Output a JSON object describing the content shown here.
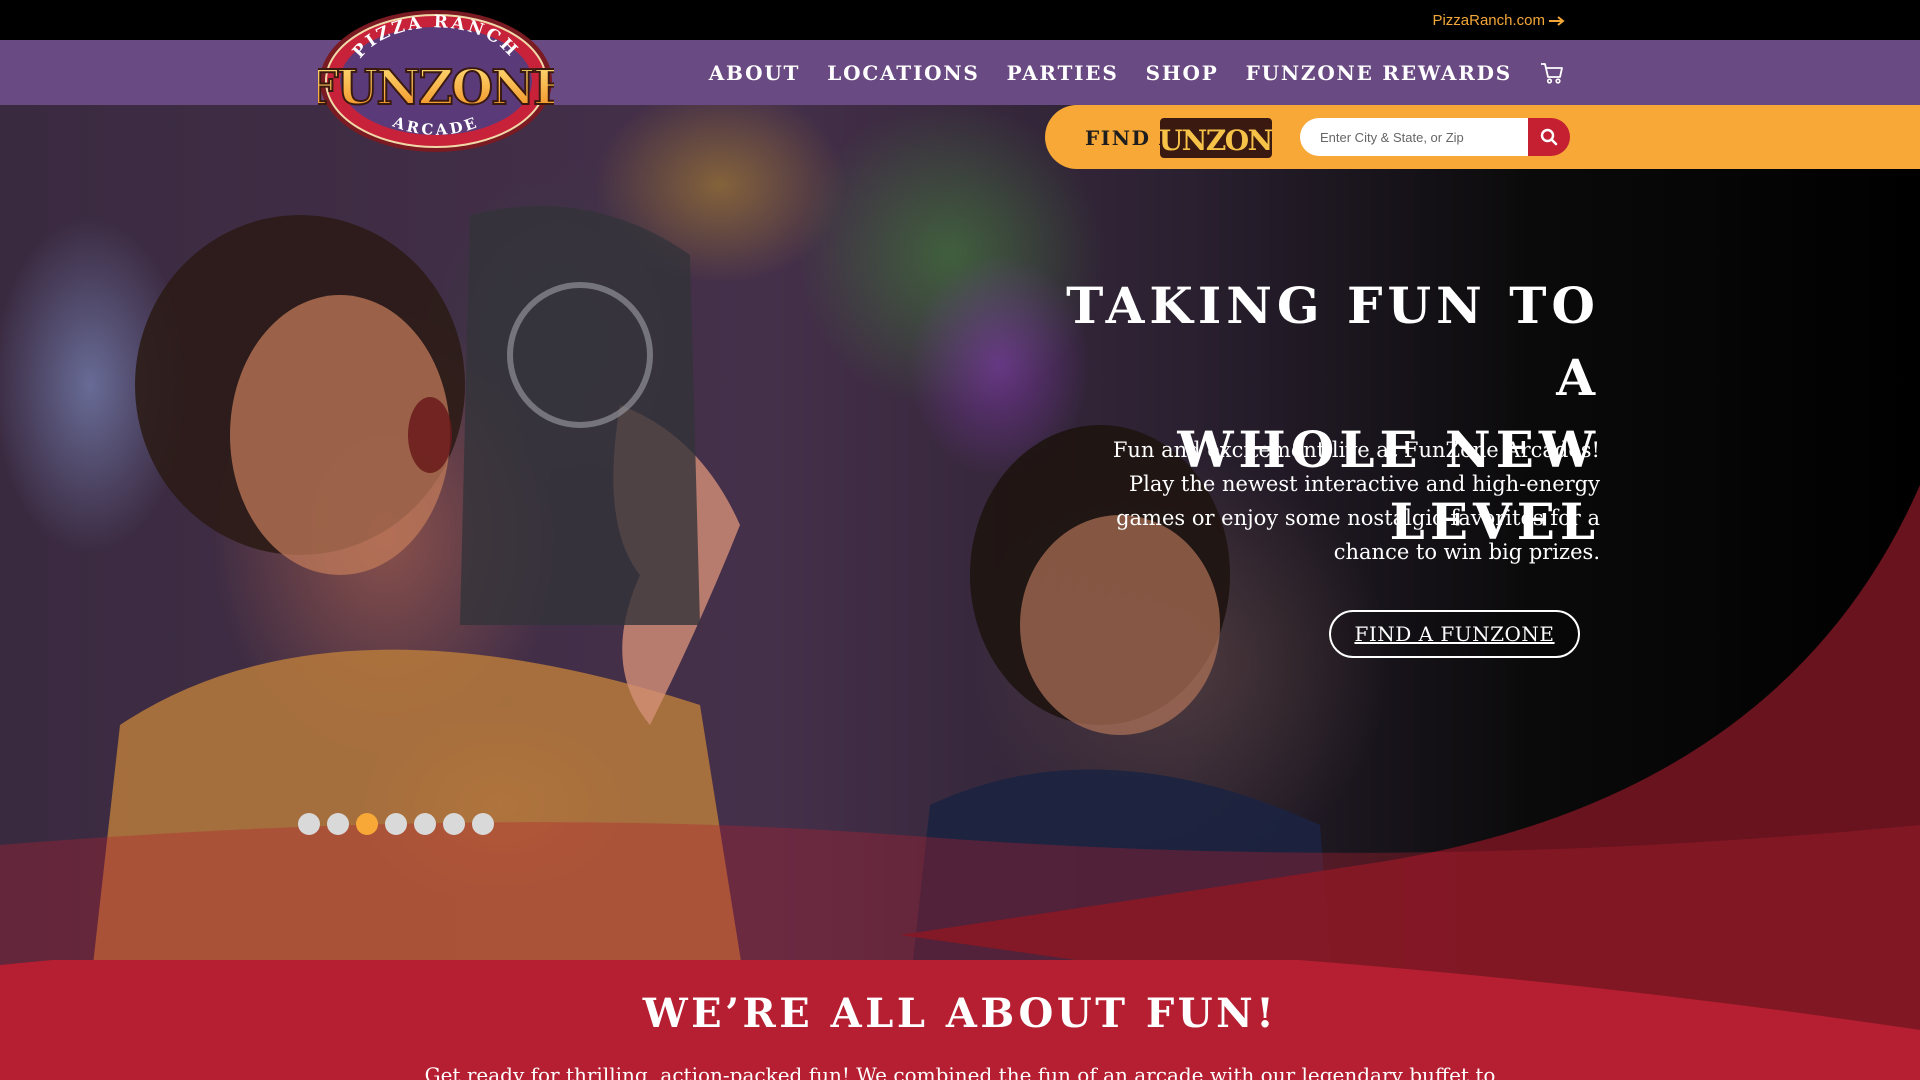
{
  "topbar": {
    "external_link": "PizzaRanch.com"
  },
  "logo": {
    "top_text": "PIZZA RANCH",
    "main_text": "FUNZONE",
    "bottom_text": "ARCADE"
  },
  "nav": {
    "items": [
      {
        "label": "ABOUT"
      },
      {
        "label": "LOCATIONS"
      },
      {
        "label": "PARTIES"
      },
      {
        "label": "SHOP"
      },
      {
        "label": "FUNZONE REWARDS"
      }
    ],
    "cart_icon": "cart-icon"
  },
  "finder": {
    "label": "FIND A",
    "logo_text": "FUNZONE",
    "placeholder": "Enter City & State, or Zip",
    "search_icon": "search-icon"
  },
  "hero": {
    "title_line1": "TAKING FUN TO A",
    "title_line2": "WHOLE NEW LEVEL",
    "text": "Fun and excitement live at FunZone Arcades! Play the newest interactive and high-energy games or enjoy some nostalgic favorites for a chance to win big prizes.",
    "button_label": "FIND A FUNZONE"
  },
  "carousel": {
    "slide_count": 7,
    "active_slide": 3
  },
  "section": {
    "title": "WE’RE ALL ABOUT FUN!",
    "text": "Get ready for thrilling, action-packed fun! We combined the fun of an arcade with our legendary buffet to"
  },
  "colors": {
    "nav_bg": "#6a4a82",
    "accent_orange": "#f7a836",
    "brand_red": "#b51f31",
    "dark_red": "#6e1420"
  }
}
